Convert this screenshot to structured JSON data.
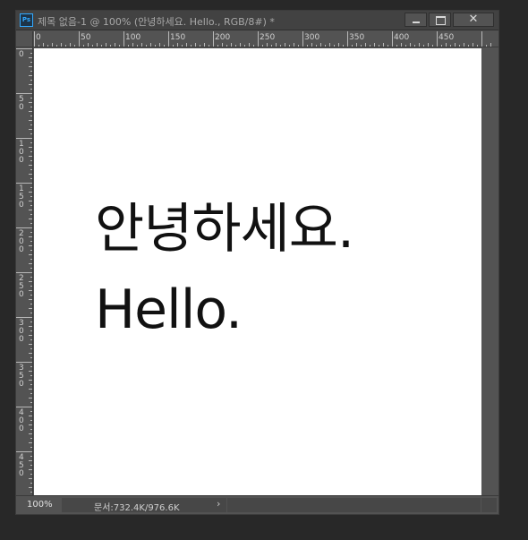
{
  "window": {
    "app_icon_label": "Ps",
    "title": "제목 없음-1 @ 100% (안녕하세요. Hello., RGB/8#) *",
    "close_glyph": "✕"
  },
  "rulers": {
    "horizontal_labels": [
      "0",
      "50",
      "100",
      "150",
      "200",
      "250",
      "300",
      "350",
      "400",
      "450"
    ],
    "vertical_labels": [
      "0",
      "50",
      "100",
      "150",
      "200",
      "250",
      "300",
      "350",
      "400",
      "450"
    ]
  },
  "canvas": {
    "background": "#ffffff",
    "text_color": "#111111",
    "text_lines": [
      "안녕하세요.",
      "Hello."
    ]
  },
  "status": {
    "zoom": "100%",
    "doc_info": "문서:732.4K/976.6K",
    "arrow": "›"
  }
}
